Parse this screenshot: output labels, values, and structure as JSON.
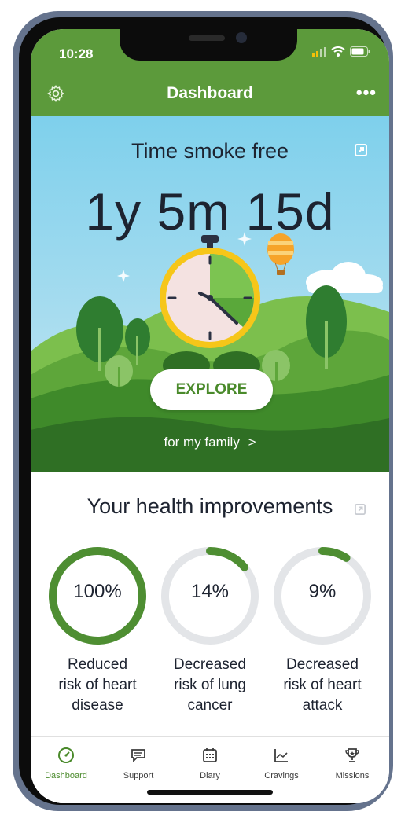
{
  "status_bar": {
    "time": "10:28"
  },
  "header": {
    "title": "Dashboard",
    "more_label": "•••"
  },
  "hero": {
    "title": "Time smoke free",
    "counter": "1y 5m 15d",
    "explore_label": "EXPLORE",
    "family_link": "for my family",
    "family_chevron": ">"
  },
  "health": {
    "title": "Your health improvements",
    "items": [
      {
        "percent_text": "100%",
        "value": 1.0,
        "label_lines": [
          "Reduced",
          "risk of heart",
          "disease"
        ]
      },
      {
        "percent_text": "14%",
        "value": 0.14,
        "label_lines": [
          "Decreased",
          "risk of lung",
          "cancer"
        ]
      },
      {
        "percent_text": "9%",
        "value": 0.09,
        "label_lines": [
          "Decreased",
          "risk of heart",
          "attack"
        ]
      }
    ]
  },
  "tabs": [
    {
      "label": "Dashboard",
      "icon": "dashboard-icon",
      "active": true
    },
    {
      "label": "Support",
      "icon": "chat-icon",
      "active": false
    },
    {
      "label": "Diary",
      "icon": "calendar-icon",
      "active": false
    },
    {
      "label": "Cravings",
      "icon": "chart-icon",
      "active": false
    },
    {
      "label": "Missions",
      "icon": "trophy-icon",
      "active": false
    }
  ],
  "colors": {
    "brand_green": "#5c9a3b",
    "ring_track": "#e3e5e8",
    "ring_fill": "#4e8e32",
    "active_tab": "#4a8a2b"
  }
}
